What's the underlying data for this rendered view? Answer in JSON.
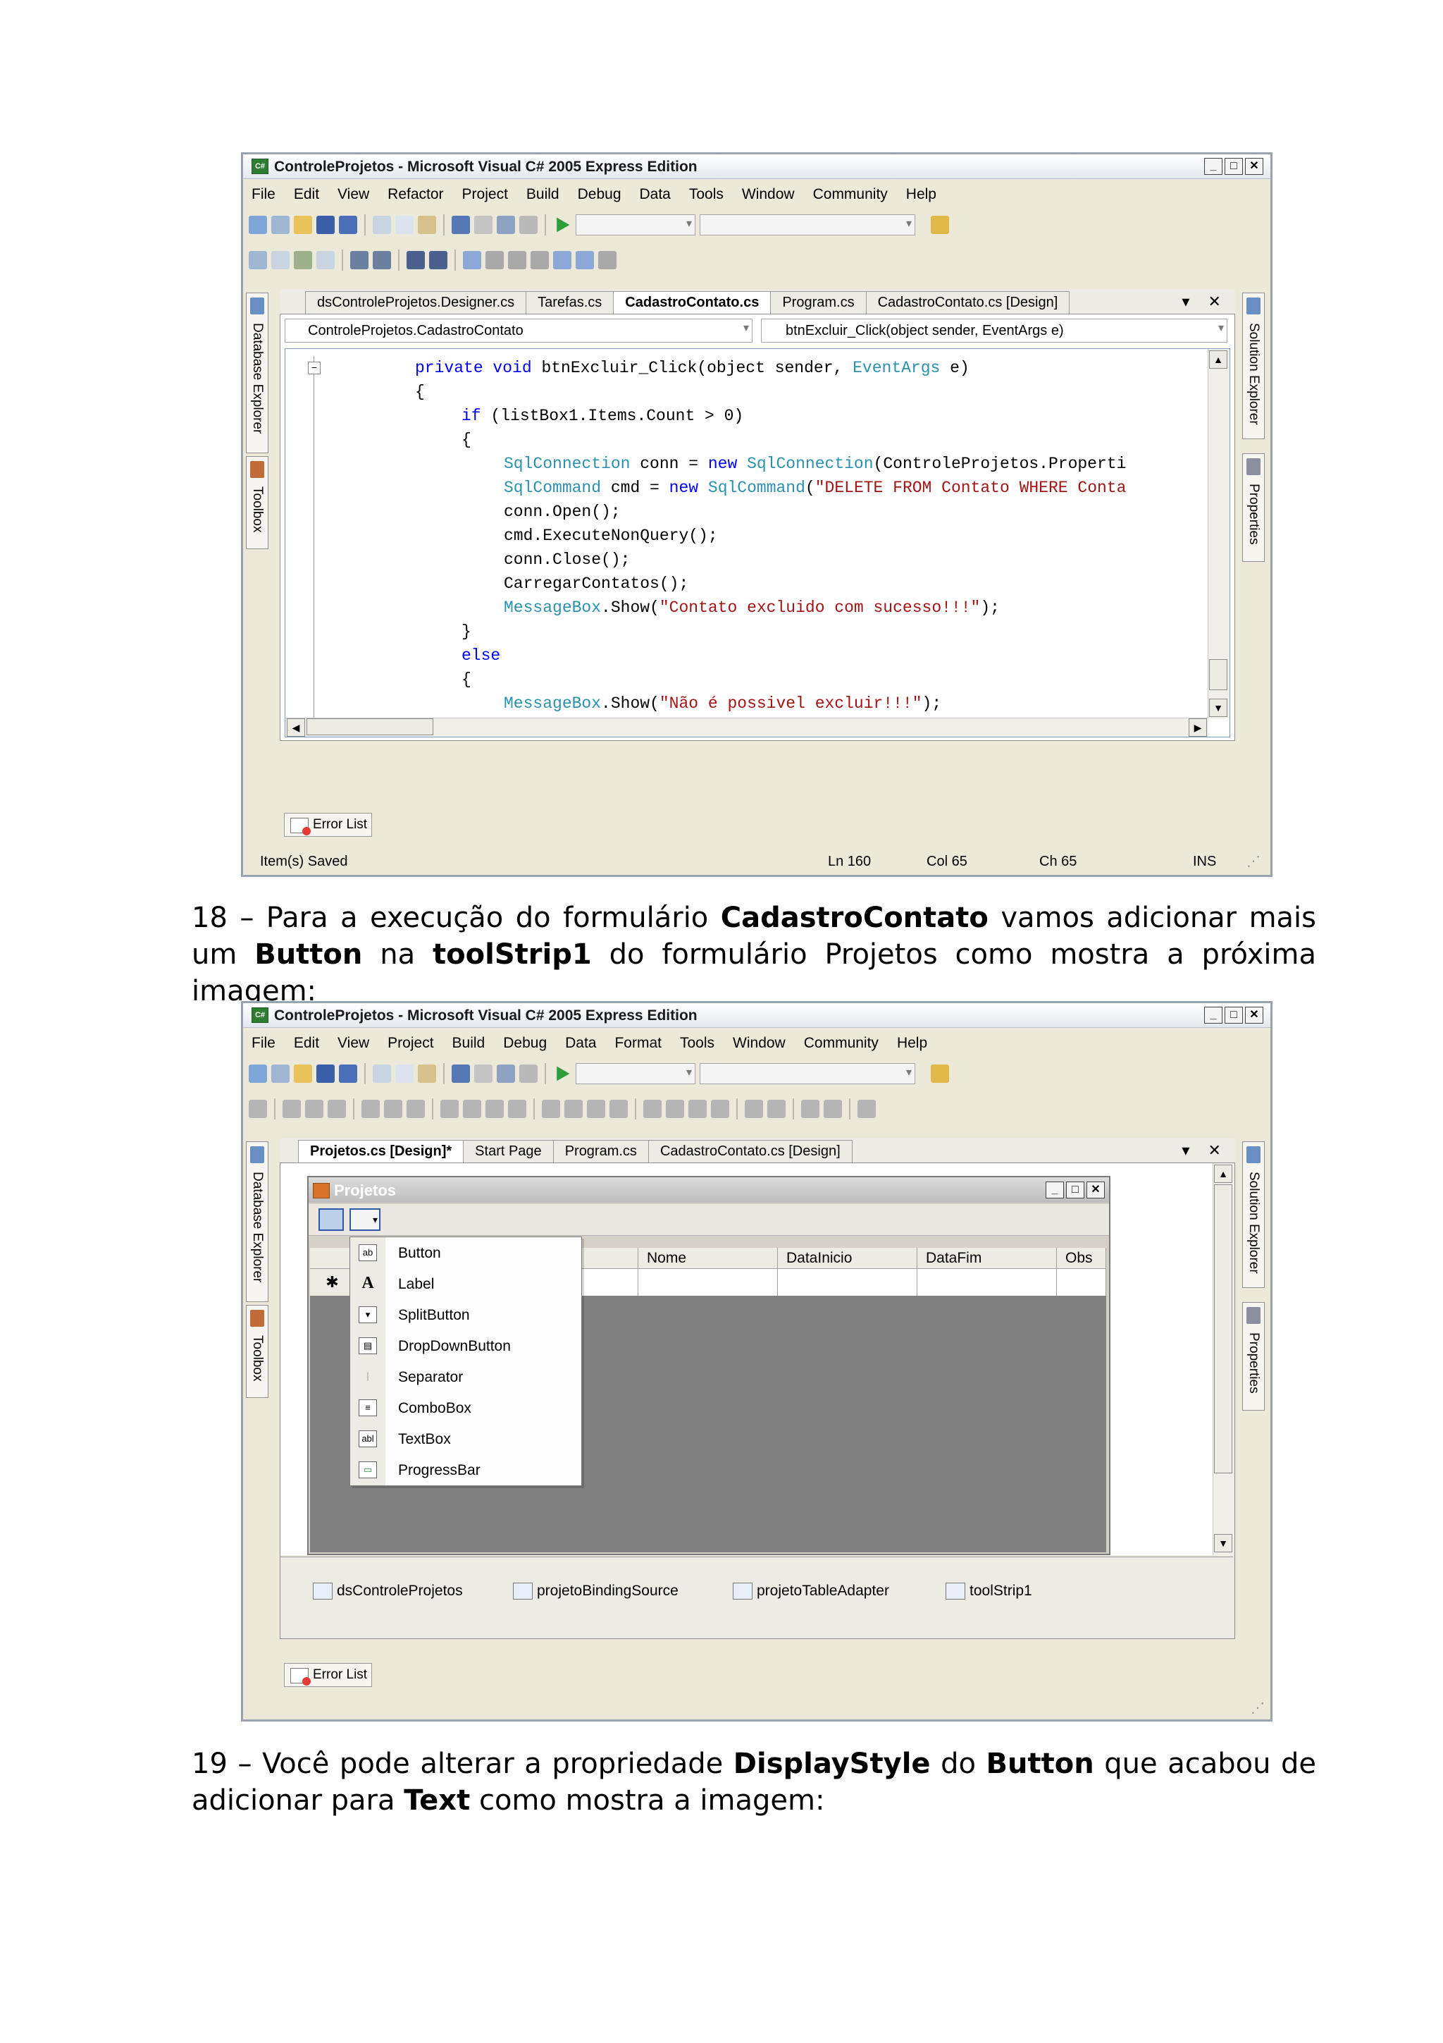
{
  "shot1": {
    "title": "ControleProjetos - Microsoft Visual C# 2005 Express Edition",
    "app_icon": "C#",
    "menu": [
      "File",
      "Edit",
      "View",
      "Refactor",
      "Project",
      "Build",
      "Debug",
      "Data",
      "Tools",
      "Window",
      "Community",
      "Help"
    ],
    "side_left": [
      "Database Explorer",
      "Toolbox"
    ],
    "side_right": [
      "Solution Explorer",
      "Properties"
    ],
    "tabs": [
      "dsControleProjetos.Designer.cs",
      "Tarefas.cs",
      "CadastroContato.cs",
      "Program.cs",
      "CadastroContato.cs [Design]"
    ],
    "tab_controls": "▾ ✕",
    "class_combo": "ControleProjetos.CadastroContato",
    "member_combo": "btnExcluir_Click(object sender, EventArgs e)",
    "code": {
      "l1a": "private void ",
      "l1b": "btnExcluir_Click(object sender, ",
      "l1c": "EventArgs",
      "l1d": " e)",
      "l2": "{",
      "l3a": "if",
      "l3b": " (listBox1.Items.Count > 0)",
      "l4": "{",
      "l5a": "SqlConnection",
      "l5b": " conn = ",
      "l5c": "new",
      "l5d": " ",
      "l5e": "SqlConnection",
      "l5f": "(ControleProjetos.Properti",
      "l6a": "SqlCommand",
      "l6b": " cmd = ",
      "l6c": "new",
      "l6d": " ",
      "l6e": "SqlCommand",
      "l6f": "(",
      "l6g": "\"DELETE FROM Contato WHERE Conta",
      "l7": "conn.Open();",
      "l8": "cmd.ExecuteNonQuery();",
      "l9": "conn.Close();",
      "l10": "CarregarContatos();",
      "l11a": "MessageBox",
      "l11b": ".Show(",
      "l11c": "\"Contato excluido com sucesso!!!\"",
      "l11d": ");",
      "l12": "}",
      "l13": "else",
      "l14": "{",
      "l15a": "MessageBox",
      "l15b": ".Show(",
      "l15c": "\"Não é possivel excluir!!!\"",
      "l15d": ");",
      "l16": "}",
      "l17": "}"
    },
    "error_list": "Error List",
    "status": {
      "left": "Item(s) Saved",
      "ln": "Ln 160",
      "col": "Col 65",
      "ch": "Ch 65",
      "ins": "INS"
    }
  },
  "para18": {
    "t1": "18 – Para a execução do formulário ",
    "b1": "CadastroContato",
    "t2": " vamos adicionar mais um ",
    "b2": "Button",
    "t3": " na ",
    "b3": "toolStrip1",
    "t4": " do formulário Projetos como mostra a próxima imagem:"
  },
  "shot2": {
    "title": "ControleProjetos - Microsoft Visual C# 2005 Express Edition",
    "app_icon": "C#",
    "menu": [
      "File",
      "Edit",
      "View",
      "Project",
      "Build",
      "Debug",
      "Data",
      "Format",
      "Tools",
      "Window",
      "Community",
      "Help"
    ],
    "side_left": [
      "Database Explorer",
      "Toolbox"
    ],
    "side_right": [
      "Solution Explorer",
      "Properties"
    ],
    "tabs": [
      "Projetos.cs [Design]*",
      "Start Page",
      "Program.cs",
      "CadastroContato.cs [Design]"
    ],
    "tab_controls": "▾ ✕",
    "form_title": "Projetos",
    "grid_columns": [
      "Nome",
      "DataInicio",
      "DataFim",
      "Obs"
    ],
    "new_row_marker": "✱",
    "dropdown": [
      {
        "icon": "ab",
        "label": "Button"
      },
      {
        "icon": "A",
        "label": "Label"
      },
      {
        "icon": "▾",
        "label": "SplitButton"
      },
      {
        "icon": "▤",
        "label": "DropDownButton"
      },
      {
        "icon": "|",
        "label": "Separator"
      },
      {
        "icon": "≡",
        "label": "ComboBox"
      },
      {
        "icon": "abl",
        "label": "TextBox"
      },
      {
        "icon": "▭",
        "label": "ProgressBar"
      }
    ],
    "tray": [
      "dsControleProjetos",
      "projetoBindingSource",
      "projetoTableAdapter",
      "toolStrip1"
    ],
    "error_list": "Error List"
  },
  "para19": {
    "t1": "19 – Você pode alterar a propriedade ",
    "b1": "DisplayStyle",
    "t2": " do ",
    "b2": "Button",
    "t3": " que acabou de adicionar para ",
    "b3": "Text",
    "t4": " como mostra a imagem:"
  },
  "colors": {
    "keyword": "#0000ff",
    "type": "#2b91af",
    "string": "#a31515"
  }
}
